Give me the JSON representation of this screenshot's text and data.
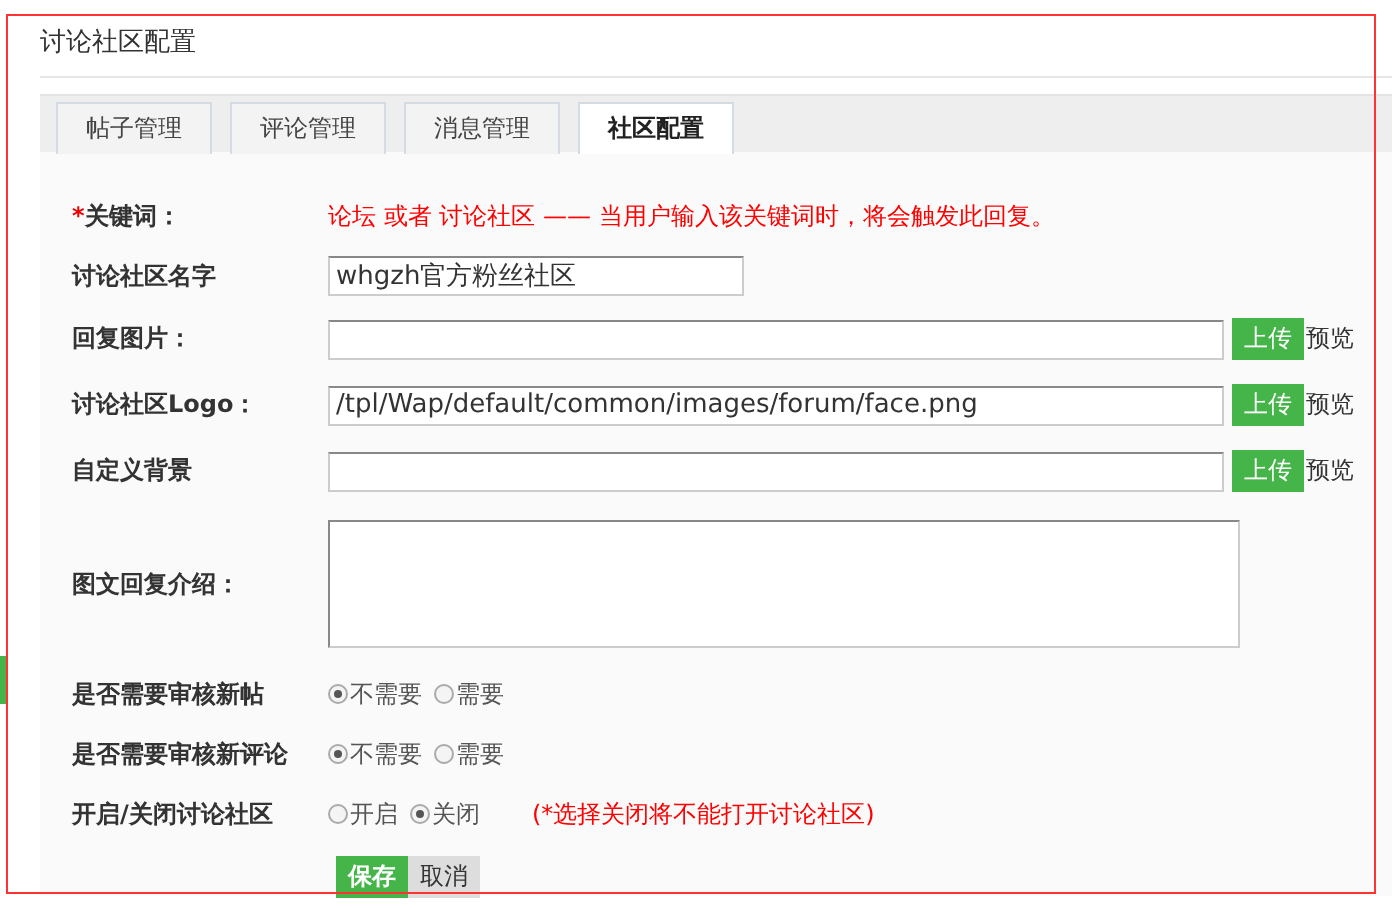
{
  "title": "讨论社区配置",
  "tabs": [
    {
      "label": "帖子管理",
      "selected": false
    },
    {
      "label": "评论管理",
      "selected": false
    },
    {
      "label": "消息管理",
      "selected": false
    },
    {
      "label": "社区配置",
      "selected": true
    }
  ],
  "form": {
    "rows": [
      {
        "kind": "note",
        "required_mark": "*",
        "label": "关键词：",
        "text": "论坛 或者 讨论社区 —— 当用户输入该关键词时，将会触发此回复。"
      },
      {
        "kind": "text",
        "label": "讨论社区名字",
        "value": "whgzh官方粉丝社区"
      },
      {
        "kind": "upload",
        "label": "回复图片：",
        "button": "上传",
        "link": "预览"
      },
      {
        "kind": "upload",
        "label": "讨论社区Logo：",
        "value": "/tpl/Wap/default/common/images/forum/face.png",
        "button": "上传",
        "link": "预览"
      },
      {
        "kind": "upload",
        "label": "自定义背景",
        "button": "上传",
        "link": "预览"
      },
      {
        "kind": "textarea",
        "label": "图文回复介绍："
      },
      {
        "kind": "radio",
        "label": "是否需要审核新帖",
        "options": [
          {
            "label": "不需要",
            "selected": true
          },
          {
            "label": "需要",
            "selected": false
          }
        ]
      },
      {
        "kind": "radio",
        "label": "是否需要审核新评论",
        "options": [
          {
            "label": "不需要",
            "selected": true
          },
          {
            "label": "需要",
            "selected": false
          }
        ]
      },
      {
        "kind": "radio",
        "label": "开启/关闭讨论社区",
        "options": [
          {
            "label": "开启",
            "selected": false
          },
          {
            "label": "关闭",
            "selected": true
          }
        ],
        "note": "(*选择关闭将不能打开讨论社区)"
      }
    ],
    "actions": [
      {
        "label": "保存",
        "kind": "primary"
      },
      {
        "label": "取消",
        "kind": "secondary"
      }
    ]
  }
}
